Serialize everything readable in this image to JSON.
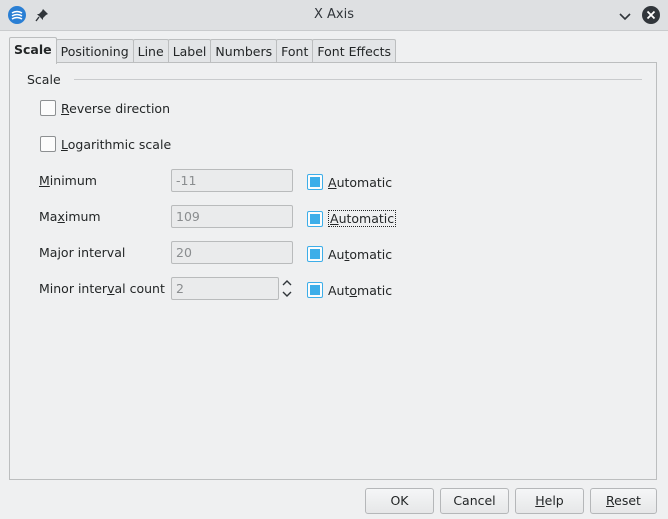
{
  "window": {
    "title": "X Axis"
  },
  "tabs": [
    {
      "label": "Scale",
      "active": true
    },
    {
      "label": "Positioning",
      "active": false
    },
    {
      "label": "Line",
      "active": false
    },
    {
      "label": "Label",
      "active": false
    },
    {
      "label": "Numbers",
      "active": false
    },
    {
      "label": "Font",
      "active": false
    },
    {
      "label": "Font Effects",
      "active": false
    }
  ],
  "scale": {
    "group_label": "Scale",
    "reverse_direction": {
      "label_mnemonic": "R",
      "label_rest": "everse direction",
      "checked": false
    },
    "logarithmic_scale": {
      "label_mnemonic": "L",
      "label_rest": "ogarithmic scale",
      "checked": false
    },
    "minimum": {
      "label_pre": "",
      "label_mnemonic": "M",
      "label_post": "inimum",
      "value": "-11",
      "auto_pre": "",
      "auto_mnemonic": "A",
      "auto_post": "utomatic",
      "auto_checked": true
    },
    "maximum": {
      "label_pre": "Ma",
      "label_mnemonic": "x",
      "label_post": "imum",
      "value": "109",
      "auto_pre": "",
      "auto_mnemonic": "A",
      "auto_post": "utomatic",
      "auto_checked": true
    },
    "major_interval": {
      "label_pre": "Major interval",
      "label_mnemonic": "",
      "label_post": "",
      "value": "20",
      "auto_pre": "Au",
      "auto_mnemonic": "t",
      "auto_post": "omatic",
      "auto_checked": true
    },
    "minor_interval_count": {
      "label_pre": "Minor inter",
      "label_mnemonic": "v",
      "label_post": "al count",
      "value": "2",
      "auto_pre": "Aut",
      "auto_mnemonic": "o",
      "auto_post": "matic",
      "auto_checked": true
    }
  },
  "buttons": {
    "ok": "OK",
    "cancel": "Cancel",
    "help_mnemonic": "H",
    "help_rest": "elp",
    "reset_mnemonic": "R",
    "reset_rest": "eset"
  },
  "colors": {
    "accent": "#3daee9",
    "background": "#eff0f1"
  }
}
